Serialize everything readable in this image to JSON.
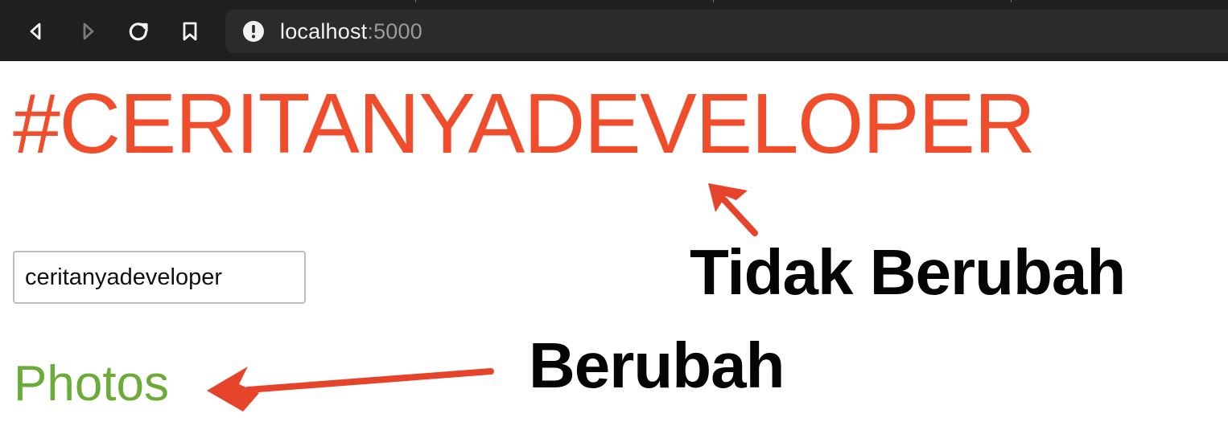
{
  "browser": {
    "address": {
      "host": "localhost",
      "port": ":5000"
    },
    "icons": {
      "back": "back-arrow-icon",
      "forward": "forward-arrow-icon",
      "reload": "reload-icon",
      "bookmark": "bookmark-icon",
      "info": "info-icon"
    }
  },
  "page": {
    "title": "#CERITANYADEVELOPER",
    "input_value": "ceritanyadeveloper",
    "link_text": "Photos"
  },
  "annotations": {
    "unchanged": "Tidak Berubah",
    "changed": "Berubah"
  },
  "colors": {
    "title": "#ef4d2b",
    "link": "#6bab38",
    "arrow": "#e6432b"
  }
}
